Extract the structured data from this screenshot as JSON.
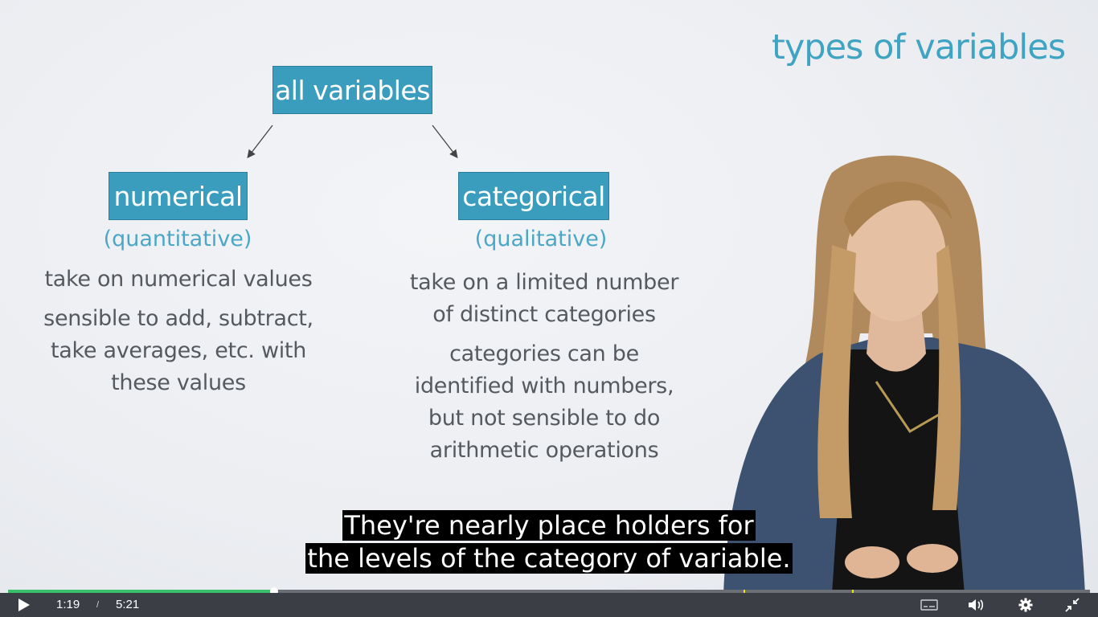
{
  "slide": {
    "title": "types of variables",
    "root_box": "all variables",
    "numerical": {
      "box": "numerical",
      "subtitle": "(quantitative)",
      "line1": "take on numerical values",
      "line2": [
        "sensible to add, subtract,",
        "take averages, etc. with",
        "these values"
      ]
    },
    "categorical": {
      "box": "categorical",
      "subtitle": "(qualitative)",
      "line1": [
        "take on a limited number",
        "of distinct categories"
      ],
      "line2": [
        "categories can be",
        "identified with numbers,",
        "but not sensible to do",
        "arithmetic operations"
      ]
    },
    "accent_color": "#3a9dbd"
  },
  "captions": {
    "line1": "They're nearly place holders for",
    "line2": "the levels of the category of variable."
  },
  "player": {
    "current_time": "1:19",
    "separator": "/",
    "duration": "5:21",
    "progress_fraction": 0.246,
    "marker_fractions": [
      0.68,
      0.78
    ],
    "played_color": "#3cbf6a",
    "icons": [
      "play-icon",
      "closed-captions-icon",
      "volume-icon",
      "settings-gear-icon",
      "exit-fullscreen-icon"
    ]
  }
}
